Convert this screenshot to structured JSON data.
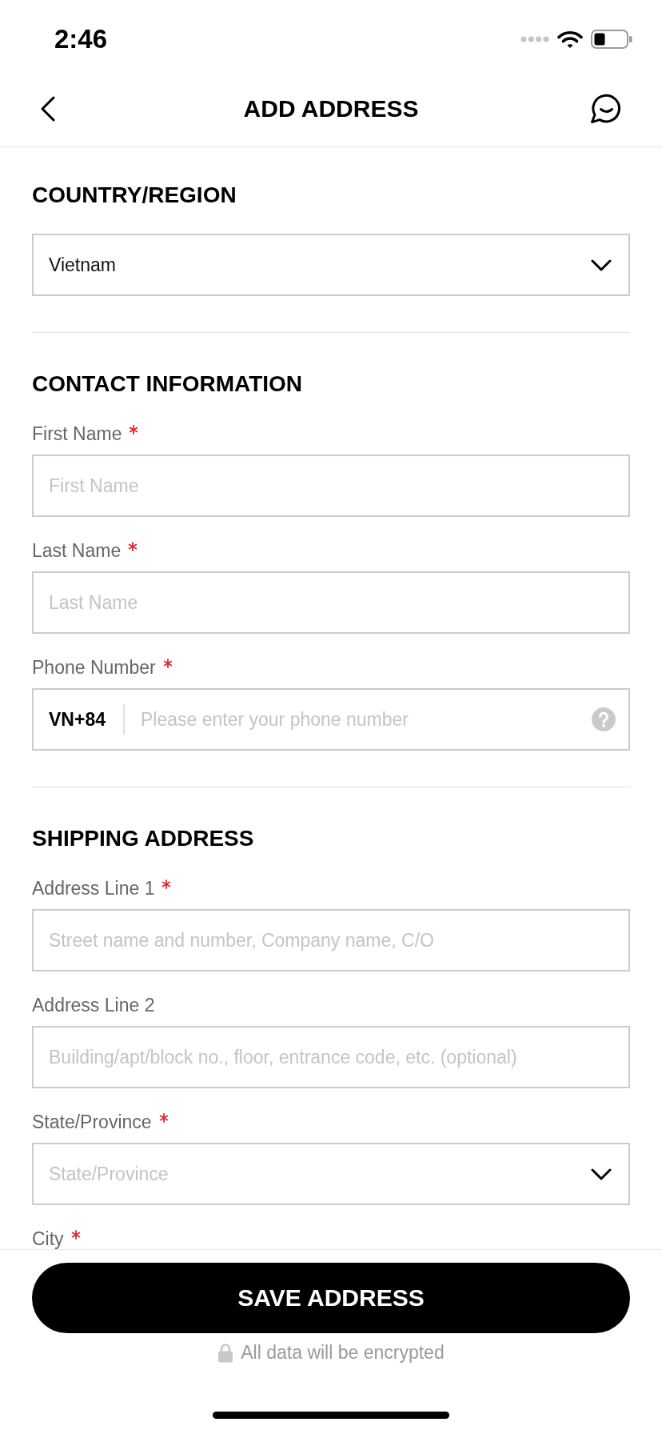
{
  "status_bar": {
    "time": "2:46"
  },
  "header": {
    "title": "ADD ADDRESS"
  },
  "sections": [
    {
      "title": "COUNTRY/REGION",
      "fields": [
        {
          "kind": "select",
          "value": "Vietnam"
        }
      ]
    },
    {
      "title": "CONTACT INFORMATION",
      "fields": [
        {
          "kind": "text",
          "label": "First Name",
          "required": true,
          "placeholder": "First Name"
        },
        {
          "kind": "text",
          "label": "Last Name",
          "required": true,
          "placeholder": "Last Name"
        },
        {
          "kind": "phone",
          "label": "Phone Number",
          "required": true,
          "prefix": "VN+84",
          "placeholder": "Please enter your phone number"
        }
      ]
    },
    {
      "title": "SHIPPING ADDRESS",
      "fields": [
        {
          "kind": "text",
          "label": "Address Line 1",
          "required": true,
          "placeholder": "Street name and number, Company name, C/O"
        },
        {
          "kind": "text",
          "label": "Address Line 2",
          "required": false,
          "placeholder": "Building/apt/block no., floor, entrance code, etc. (optional)"
        },
        {
          "kind": "select",
          "label": "State/Province",
          "required": true,
          "placeholder": "State/Province"
        },
        {
          "kind": "label",
          "label": "City",
          "required": true
        }
      ]
    }
  ],
  "footer": {
    "button": "SAVE ADDRESS",
    "note": "All data will be encrypted"
  }
}
